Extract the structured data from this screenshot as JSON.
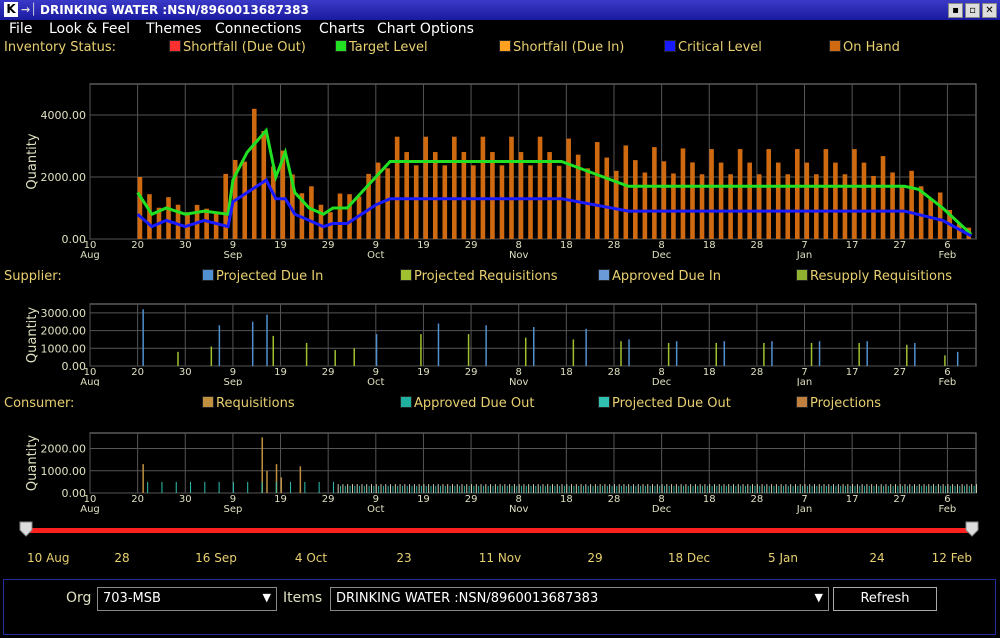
{
  "window": {
    "title": "DRINKING WATER  :NSN/8960013687383",
    "arrow_glyph": "→│",
    "app_glyph": "K"
  },
  "menu": [
    "File",
    "Look & Feel",
    "Themes",
    "Connections",
    "Charts",
    "Chart Options"
  ],
  "inventory": {
    "label": "Inventory Status:",
    "legend": [
      {
        "label": "Shortfall (Due Out)",
        "color": "#ff3030"
      },
      {
        "label": "Target Level",
        "color": "#22e022"
      },
      {
        "label": "Shortfall (Due In)",
        "color": "#ffa020"
      },
      {
        "label": "Critical Level",
        "color": "#1a1aff"
      },
      {
        "label": "On Hand",
        "color": "#d06a10"
      }
    ]
  },
  "supplier": {
    "label": "Supplier:",
    "legend": [
      {
        "label": "Projected Due In",
        "color": "#5090d0"
      },
      {
        "label": "Projected Requisitions",
        "color": "#a0c030"
      },
      {
        "label": "Approved Due In",
        "color": "#6a9ad8"
      },
      {
        "label": "Resupply Requisitions",
        "color": "#90b030"
      }
    ]
  },
  "consumer": {
    "label": "Consumer:",
    "legend": [
      {
        "label": "Requisitions",
        "color": "#c09040"
      },
      {
        "label": "Approved Due Out",
        "color": "#20b0a0"
      },
      {
        "label": "Projected Due Out",
        "color": "#30c0b0"
      },
      {
        "label": "Projections",
        "color": "#c08040"
      }
    ]
  },
  "axis": {
    "ylabel": "Quantity",
    "ticks": [
      {
        "d": 0,
        "top": "10",
        "bot": "Aug"
      },
      {
        "d": 10,
        "top": "20",
        "bot": ""
      },
      {
        "d": 20,
        "top": "30",
        "bot": ""
      },
      {
        "d": 30,
        "top": "9",
        "bot": "Sep"
      },
      {
        "d": 40,
        "top": "19",
        "bot": ""
      },
      {
        "d": 50,
        "top": "29",
        "bot": ""
      },
      {
        "d": 60,
        "top": "9",
        "bot": "Oct"
      },
      {
        "d": 70,
        "top": "19",
        "bot": ""
      },
      {
        "d": 80,
        "top": "29",
        "bot": ""
      },
      {
        "d": 90,
        "top": "8",
        "bot": "Nov"
      },
      {
        "d": 100,
        "top": "18",
        "bot": ""
      },
      {
        "d": 110,
        "top": "28",
        "bot": ""
      },
      {
        "d": 120,
        "top": "8",
        "bot": "Dec"
      },
      {
        "d": 130,
        "top": "18",
        "bot": ""
      },
      {
        "d": 140,
        "top": "28",
        "bot": ""
      },
      {
        "d": 150,
        "top": "7",
        "bot": "Jan"
      },
      {
        "d": 160,
        "top": "17",
        "bot": ""
      },
      {
        "d": 170,
        "top": "27",
        "bot": ""
      },
      {
        "d": 180,
        "top": "6",
        "bot": "Feb"
      }
    ]
  },
  "chart_data": [
    {
      "type": "area",
      "title": "Inventory Status",
      "ylabel": "Quantity",
      "xlim": [
        "10 Aug",
        "12 Feb"
      ],
      "ylim": [
        0,
        5000
      ],
      "yticks": [
        "0.00",
        "2000.00",
        "4000.00"
      ],
      "on_hand": {
        "x": [
          "20 Aug",
          "24 Aug",
          "28 Aug",
          "1 Sep",
          "5 Sep",
          "9 Sep",
          "12 Sep",
          "14 Sep",
          "16 Sep",
          "18 Sep",
          "20 Sep",
          "22 Sep",
          "24 Sep",
          "27 Sep",
          "29 Sep",
          "2 Oct",
          "5 Oct",
          "8 Oct",
          "9 Oct",
          "12 Oct",
          "20 Oct",
          "1 Nov",
          "15 Nov",
          "20 Nov",
          "1 Dec",
          "15 Dec",
          "1 Jan",
          "20 Jan",
          "28 Jan",
          "3 Feb",
          "8 Feb",
          "11 Feb"
        ],
        "y": [
          2000,
          1400,
          1300,
          1100,
          1200,
          3000,
          3700,
          4700,
          3500,
          3000,
          2700,
          2200,
          1900,
          1300,
          1200,
          1600,
          1900,
          2200,
          2900,
          3300,
          3300,
          3300,
          3300,
          3200,
          3000,
          2900,
          2900,
          2900,
          2300,
          1700,
          700,
          200
        ]
      },
      "target_level": {
        "x": [
          "20 Aug",
          "23 Aug",
          "26 Aug",
          "30 Aug",
          "3 Sep",
          "8 Sep",
          "9 Sep",
          "12 Sep",
          "16 Sep",
          "18 Sep",
          "20 Sep",
          "22 Sep",
          "25 Sep",
          "28 Sep",
          "30 Sep",
          "3 Oct",
          "6 Oct",
          "9 Oct",
          "12 Oct",
          "1 Nov",
          "17 Nov",
          "24 Nov",
          "1 Dec",
          "31 Dec",
          "28 Jan",
          "31 Jan",
          "5 Feb",
          "11 Feb"
        ],
        "y": [
          1500,
          800,
          1000,
          800,
          900,
          800,
          1900,
          2800,
          3500,
          2000,
          2800,
          1500,
          1000,
          800,
          1000,
          1000,
          1500,
          2000,
          2500,
          2500,
          2500,
          2100,
          1700,
          1700,
          1700,
          1600,
          1000,
          150
        ]
      },
      "critical_level": {
        "x": [
          "20 Aug",
          "23 Aug",
          "26 Aug",
          "30 Aug",
          "3 Sep",
          "8 Sep",
          "9 Sep",
          "13 Sep",
          "16 Sep",
          "18 Sep",
          "20 Sep",
          "22 Sep",
          "25 Sep",
          "28 Sep",
          "30 Sep",
          "3 Oct",
          "6 Oct",
          "9 Oct",
          "12 Oct",
          "1 Nov",
          "17 Nov",
          "1 Dec",
          "28 Jan",
          "5 Feb",
          "11 Feb"
        ],
        "y": [
          800,
          400,
          600,
          400,
          600,
          400,
          1200,
          1600,
          1900,
          1300,
          1300,
          800,
          600,
          400,
          500,
          500,
          800,
          1100,
          1300,
          1300,
          1300,
          900,
          900,
          600,
          100
        ]
      }
    },
    {
      "type": "bar",
      "title": "Supplier",
      "ylabel": "Quantity",
      "xlim": [
        "10 Aug",
        "12 Feb"
      ],
      "ylim": [
        0,
        3500
      ],
      "yticks": [
        "0.00",
        "1000.00",
        "2000.00",
        "3000.00"
      ],
      "series": [
        {
          "name": "Projected Due In",
          "x": [
            "21 Aug",
            "6 Sep",
            "13 Sep",
            "16 Sep",
            "9 Oct",
            "22 Oct",
            "1 Nov",
            "11 Nov",
            "22 Nov",
            "1 Dec",
            "11 Dec",
            "21 Dec",
            "31 Dec",
            "10 Jan",
            "20 Jan",
            "30 Jan",
            "8 Feb"
          ],
          "y": [
            3200,
            2300,
            2500,
            2900,
            1800,
            2400,
            2300,
            2200,
            2100,
            1500,
            1400,
            1400,
            1400,
            1400,
            1400,
            1300,
            800
          ]
        },
        {
          "name": "Projected Requisitions",
          "x": [
            "28 Aug",
            "4 Sep",
            "17 Sep",
            "24 Sep",
            "30 Sep",
            "4 Oct",
            "18 Oct",
            "28 Oct",
            "9 Nov",
            "19 Nov",
            "29 Nov",
            "9 Dec",
            "19 Dec",
            "29 Dec",
            "8 Jan",
            "18 Jan",
            "28 Jan",
            "5 Feb"
          ],
          "y": [
            800,
            1100,
            1700,
            1300,
            900,
            1000,
            1800,
            1800,
            1600,
            1500,
            1400,
            1300,
            1300,
            1300,
            1300,
            1300,
            1200,
            600
          ]
        }
      ]
    },
    {
      "type": "bar",
      "title": "Consumer",
      "ylabel": "Quantity",
      "xlim": [
        "10 Aug",
        "12 Feb"
      ],
      "ylim": [
        0,
        2700
      ],
      "yticks": [
        "0.00",
        "1000.00",
        "2000.00"
      ],
      "series": [
        {
          "name": "Requisitions",
          "x": [
            "21 Aug",
            "15 Sep",
            "16 Sep",
            "18 Sep",
            "19 Sep",
            "23 Sep"
          ],
          "y": [
            1300,
            2500,
            1000,
            1300,
            700,
            1200
          ]
        },
        {
          "name": "Projected Due Out",
          "x": [
            "1 Oct",
            "12 Feb"
          ],
          "y": [
            400,
            400
          ]
        }
      ]
    }
  ],
  "slider": {
    "labels": [
      "10 Aug",
      "28",
      "16 Sep",
      "4 Oct",
      "23",
      "11 Nov",
      "29",
      "18 Dec",
      "5 Jan",
      "24",
      "12 Feb"
    ]
  },
  "bottom": {
    "org_label": "Org",
    "org_value": "703-MSB",
    "items_label": "Items",
    "items_value": "DRINKING WATER  :NSN/8960013687383",
    "refresh_label": "Refresh"
  }
}
